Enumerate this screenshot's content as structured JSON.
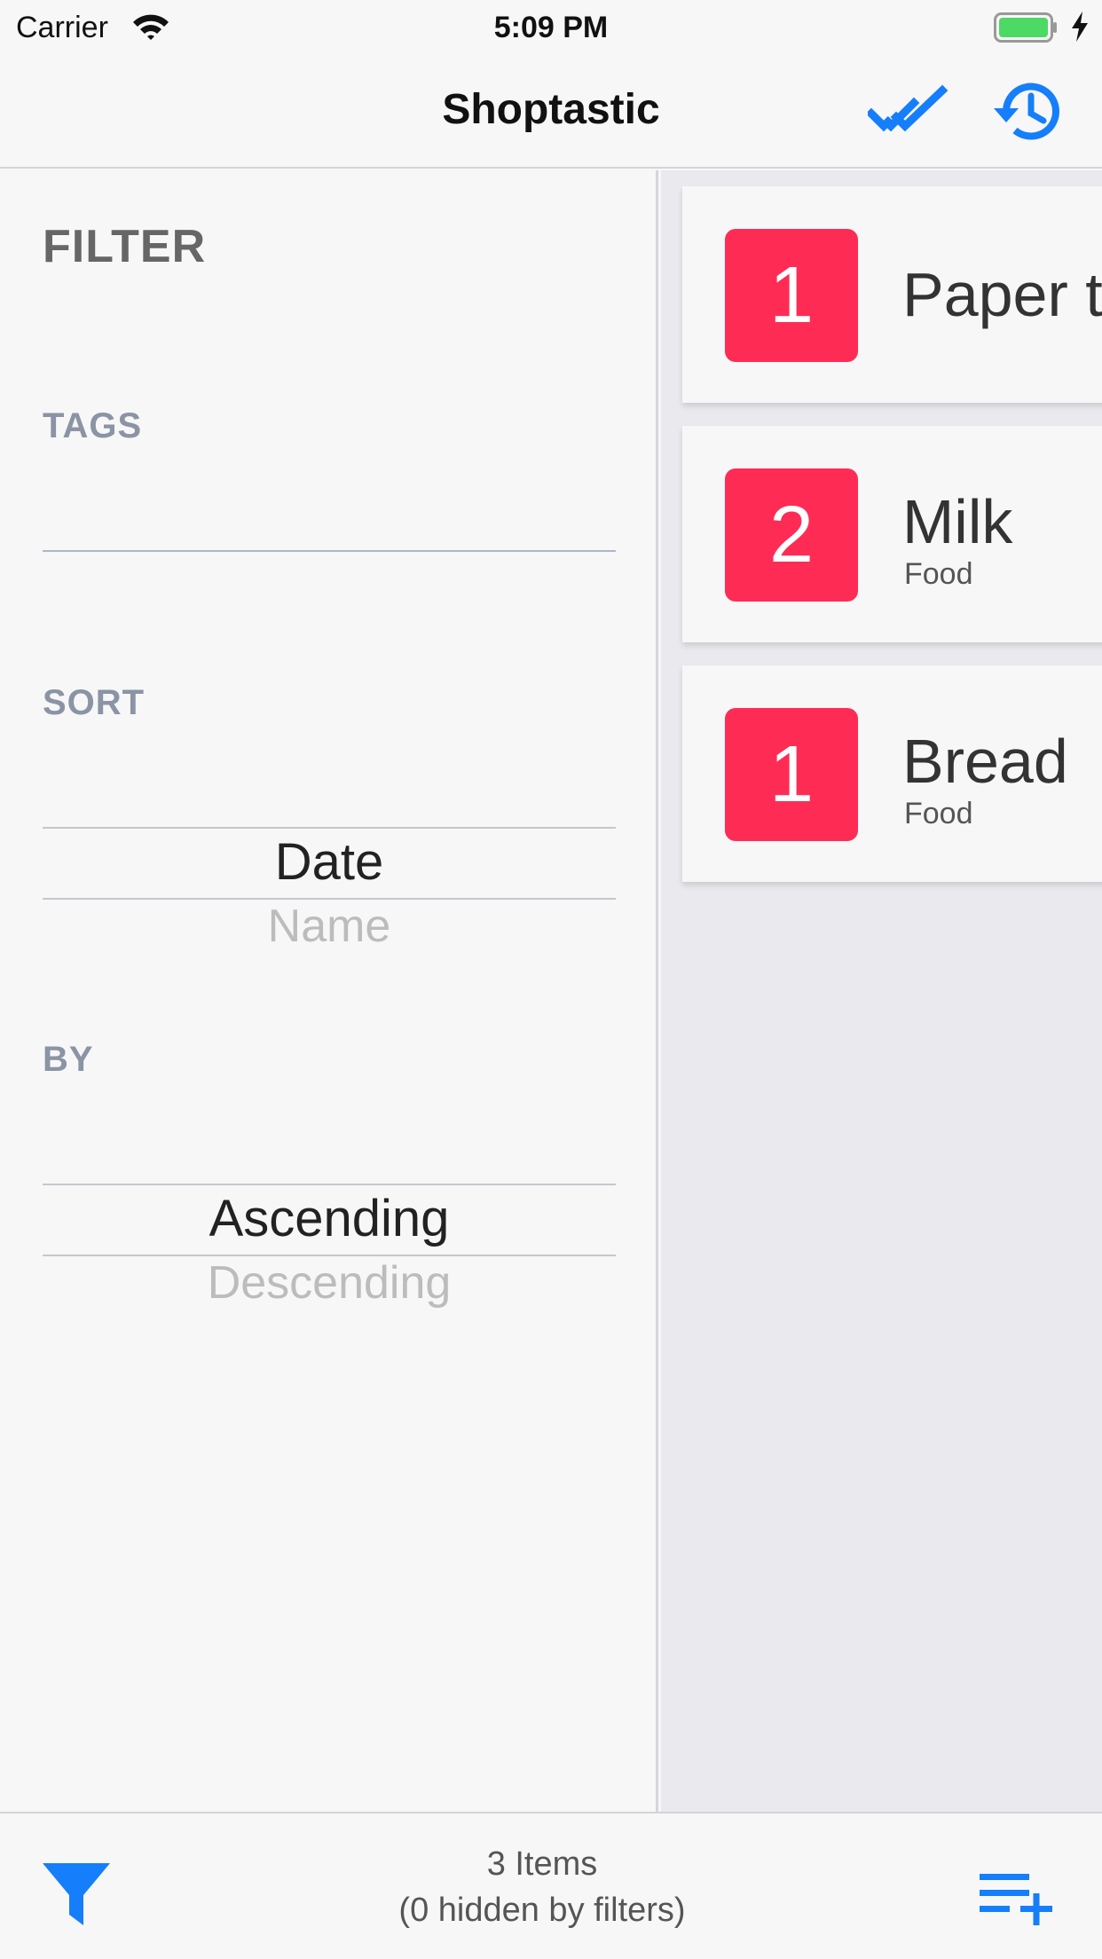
{
  "status_bar": {
    "carrier": "Carrier",
    "time": "5:09 PM"
  },
  "nav": {
    "title": "Shoptastic",
    "icons": [
      "double-check-icon",
      "history-icon"
    ]
  },
  "filter_panel": {
    "heading": "FILTER",
    "tags_label": "TAGS",
    "tags_value": "",
    "sort_label": "SORT",
    "sort_selected": "Date",
    "sort_next": "Name",
    "by_label": "BY",
    "by_selected": "Ascending",
    "by_next": "Descending"
  },
  "items": [
    {
      "quantity": "1",
      "name": "Paper towels",
      "tag": ""
    },
    {
      "quantity": "2",
      "name": "Milk",
      "tag": "Food"
    },
    {
      "quantity": "1",
      "name": "Bread",
      "tag": "Food"
    }
  ],
  "toolbar": {
    "count": "3 Items",
    "hidden": "(0 hidden by filters)",
    "icons": [
      "filter-funnel-icon",
      "add-to-list-icon"
    ]
  },
  "colors": {
    "accent": "#157efb",
    "badge": "#fe2c55",
    "battery": "#4cd964"
  }
}
